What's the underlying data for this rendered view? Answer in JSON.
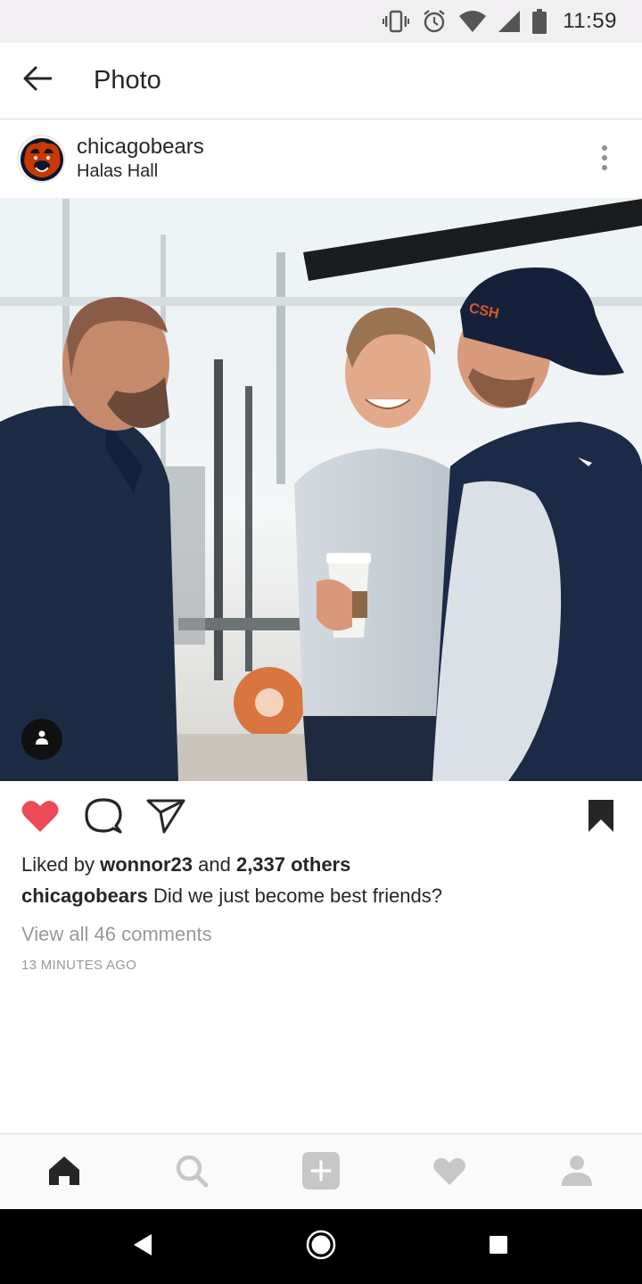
{
  "status_bar": {
    "time": "11:59",
    "icons": [
      "vibrate-icon",
      "alarm-icon",
      "wifi-icon",
      "signal-icon",
      "battery-icon"
    ]
  },
  "header": {
    "title": "Photo",
    "back_icon": "arrow-left-icon"
  },
  "post": {
    "username": "chicagobears",
    "location": "Halas Hall",
    "avatar_icon": "bears-logo",
    "more_icon": "more-vertical-icon",
    "photo_icon": "photo",
    "tag_icon": "person-tag-icon"
  },
  "actions": {
    "like_icon": "heart-filled-icon",
    "comment_icon": "comment-icon",
    "share_icon": "send-icon",
    "save_icon": "bookmark-filled-icon",
    "like_color": "#ed4956"
  },
  "likes": {
    "prefix": "Liked by",
    "user": "wonnor23",
    "conj": "and",
    "others": "2,337 others"
  },
  "caption": {
    "username": "chicagobears",
    "text": "Did we just become best friends?"
  },
  "comments": {
    "view_all": "View all 46 comments"
  },
  "timestamp": "13 MINUTES AGO",
  "bottom_nav": {
    "items": [
      "home-icon",
      "search-icon",
      "add-icon",
      "activity-heart-icon",
      "profile-icon"
    ]
  },
  "system_nav": {
    "items": [
      "back-triangle-icon",
      "home-circle-icon",
      "recents-square-icon"
    ]
  }
}
